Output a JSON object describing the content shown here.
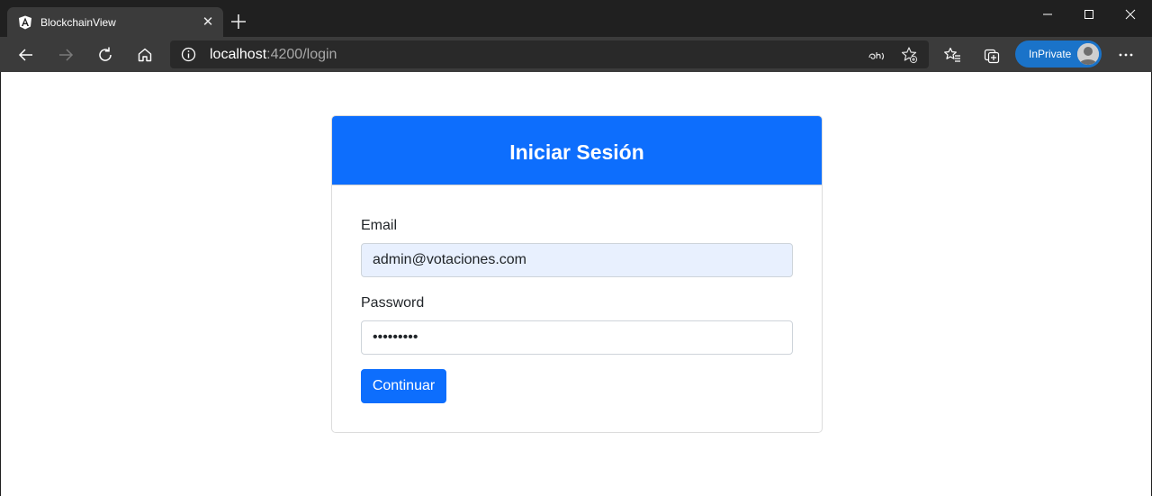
{
  "browser": {
    "tab": {
      "title": "BlockchainView",
      "close_glyph": "✕"
    },
    "address": {
      "host": "localhost",
      "path": ":4200/login"
    },
    "inprivate_label": "InPrivate",
    "icons": {
      "favicon": "angular-icon",
      "back": "back-arrow-icon",
      "forward": "forward-arrow-icon",
      "refresh": "refresh-icon",
      "home": "home-icon",
      "info": "info-icon",
      "translate": "translate-icon",
      "favorite_add": "star-add-icon",
      "favorites": "favorites-icon",
      "collections": "collections-icon",
      "menu": "more-icon"
    }
  },
  "login": {
    "title": "Iniciar Sesión",
    "email_label": "Email",
    "email_value": "admin@votaciones.com",
    "password_label": "Password",
    "password_value": "•••••••••",
    "submit_label": "Continuar"
  },
  "colors": {
    "primary": "#0d6efd",
    "autofill_bg": "#e8f0fe",
    "chrome_dark": "#202020",
    "toolbar": "#3b3b3b",
    "inprivate": "#1a73c9"
  }
}
